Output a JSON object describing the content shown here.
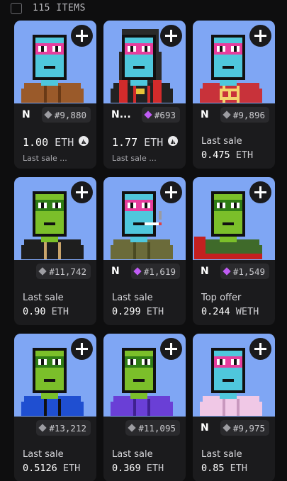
{
  "header": {
    "items_count": "115 ITEMS"
  },
  "colors": {
    "background": "#0e0e0f",
    "card": "#1b1b1d",
    "art_bg": "#7fa6f4",
    "rank_gray": "#9d9da2",
    "rank_purple": "#c05cf5"
  },
  "cards": [
    {
      "name": "N",
      "rank": "#9,880",
      "rank_tier": "gray",
      "mode": "price",
      "price": "1.00",
      "currency": "ETH",
      "sub": "Last sale ...",
      "marketplace_icon": "sailboat-icon",
      "art": {
        "hair": "none",
        "face": "#4fc7dc",
        "mask": "#e73d9d",
        "outfit": "#9a5a2a",
        "outfit_detail": "#6a3a16",
        "extra": "none"
      }
    },
    {
      "name": "N...",
      "rank": "#693",
      "rank_tier": "purple",
      "mode": "price",
      "price": "1.77",
      "currency": "ETH",
      "sub": "Last sale ...",
      "marketplace_icon": "blur-icon",
      "art": {
        "hair": "#2a2a2a",
        "face": "#4fc7dc",
        "mask": "#e73d9d",
        "outfit": "#222222",
        "outfit_detail": "#d22b2b",
        "extra": "chain"
      }
    },
    {
      "name": "N",
      "rank": "#9,896",
      "rank_tier": "gray",
      "mode": "label",
      "label": "Last sale",
      "value": "0.475",
      "currency": "ETH",
      "art": {
        "hair": "none",
        "face": "#4fc7dc",
        "mask": "#e73d9d",
        "outfit": "#c8323a",
        "outfit_detail": "#f2d36b",
        "extra": "jersey"
      }
    },
    {
      "name": "",
      "rank": "#11,742",
      "rank_tier": "gray",
      "mode": "label",
      "label": "Last sale",
      "value": "0.90",
      "currency": "ETH",
      "art": {
        "hair": "none",
        "face": "#7bbf2a",
        "mask": "#2f7d16",
        "outfit": "#1e1e1e",
        "outfit_detail": "#c9a46a",
        "extra": "none"
      }
    },
    {
      "name": "N",
      "rank": "#1,619",
      "rank_tier": "purple",
      "mode": "label",
      "label": "Last sale",
      "value": "0.299",
      "currency": "ETH",
      "art": {
        "hair": "none",
        "face": "#4fc7dc",
        "mask": "#e73d9d",
        "outfit": "#6b6b3a",
        "outfit_detail": "#4a4a22",
        "extra": "cigarette"
      }
    },
    {
      "name": "N",
      "rank": "#1,549",
      "rank_tier": "purple",
      "mode": "label",
      "label": "Top offer",
      "value": "0.244",
      "currency": "WETH",
      "art": {
        "hair": "none",
        "face": "#7bbf2a",
        "mask": "#2f7d16",
        "outfit": "#3f6a2a",
        "outfit_detail": "#c42020",
        "extra": "cape"
      }
    },
    {
      "name": "",
      "rank": "#13,212",
      "rank_tier": "gray",
      "mode": "label",
      "label": "Last sale",
      "value": "0.5126",
      "currency": "ETH",
      "art": {
        "hair": "none",
        "face": "#7bbf2a",
        "mask": "#2f7d16",
        "outfit": "#1f4fd1",
        "outfit_detail": "#111111",
        "extra": "none"
      }
    },
    {
      "name": "",
      "rank": "#11,095",
      "rank_tier": "gray",
      "mode": "label",
      "label": "Last sale",
      "value": "0.369",
      "currency": "ETH",
      "art": {
        "hair": "none",
        "face": "#7bbf2a",
        "mask": "#2f7d16",
        "outfit": "#6a3fd6",
        "outfit_detail": "#3f2190",
        "extra": "none"
      }
    },
    {
      "name": "N",
      "rank": "#9,975",
      "rank_tier": "gray",
      "mode": "label",
      "label": "Last sale",
      "value": "0.85",
      "currency": "ETH",
      "art": {
        "hair": "none",
        "face": "#4fc7dc",
        "mask": "#e73d9d",
        "outfit": "#f0c8e6",
        "outfit_detail": "#c898be",
        "extra": "none"
      }
    }
  ]
}
